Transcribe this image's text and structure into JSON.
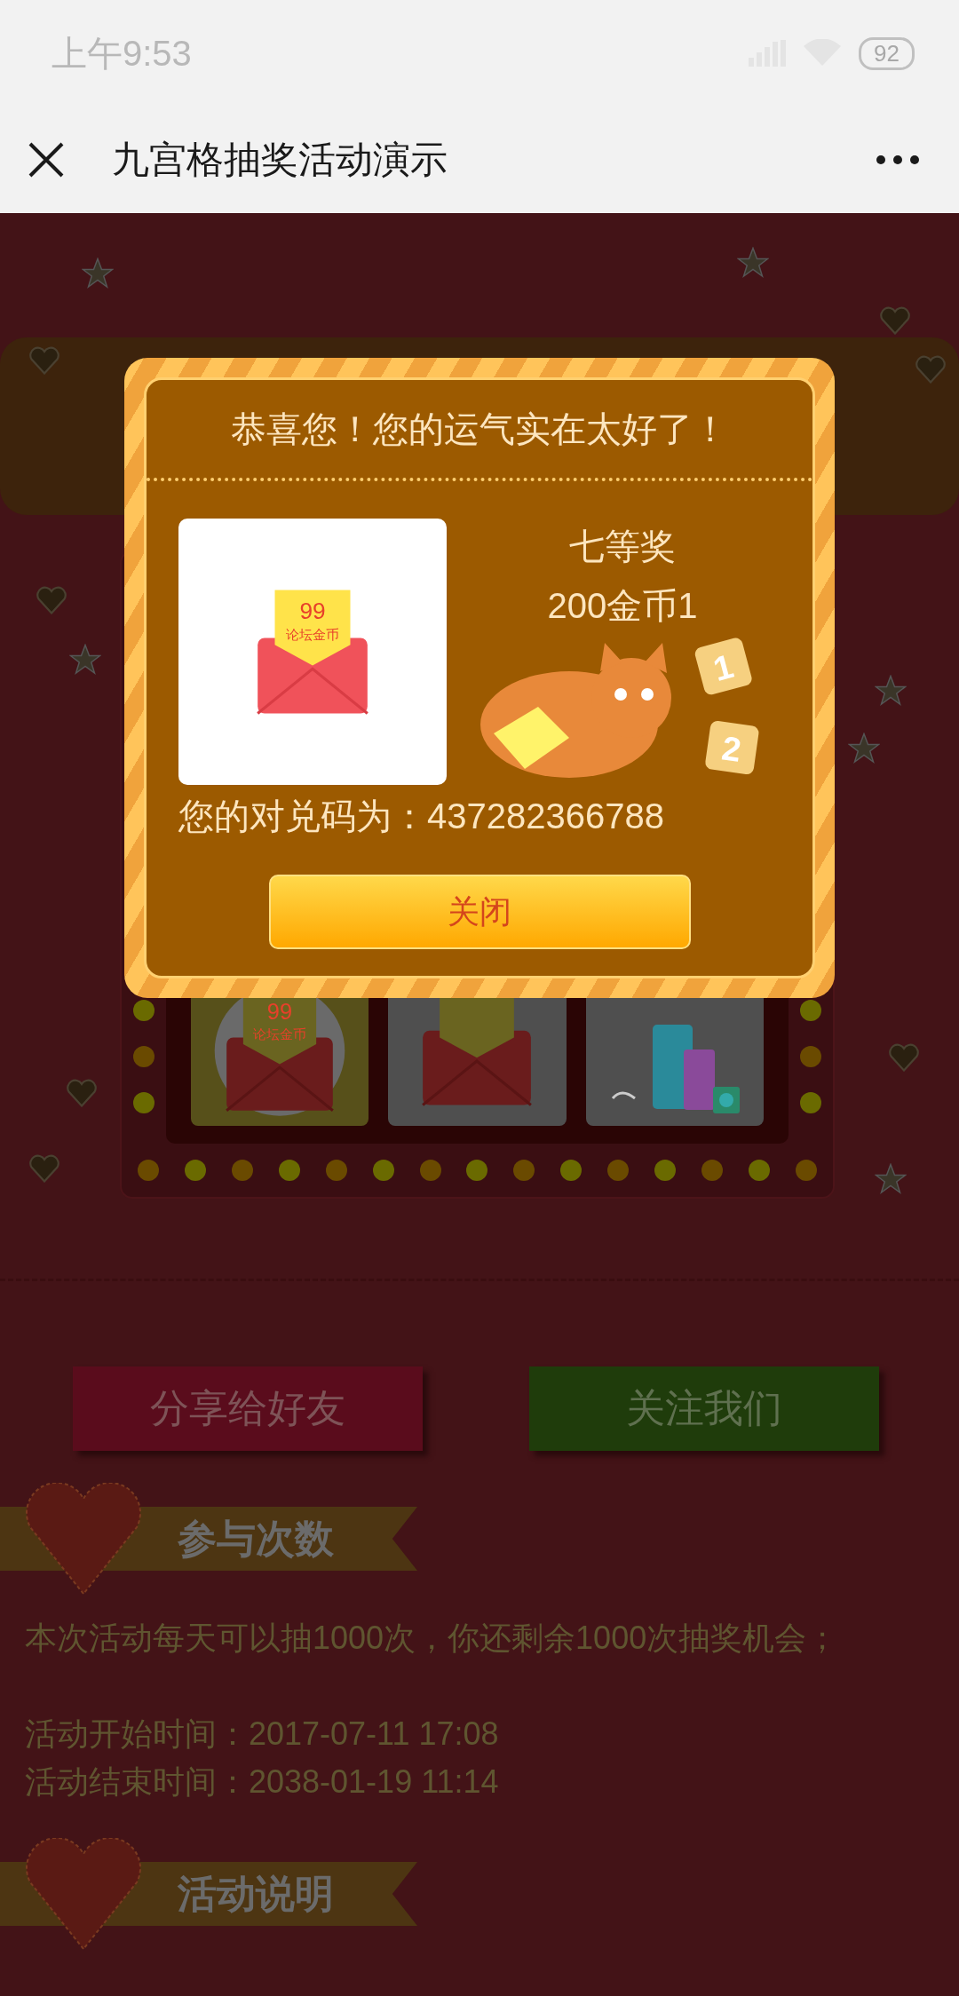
{
  "status_bar": {
    "time": "上午9:53",
    "battery": "92"
  },
  "nav": {
    "title": "九宫格抽奖活动演示"
  },
  "grid": {
    "cells": [
      {
        "kind": "coins",
        "amount": "99",
        "label": "论坛金币",
        "selected": true
      },
      {
        "kind": "envelope",
        "selected": false
      },
      {
        "kind": "device",
        "selected": false
      }
    ]
  },
  "actions": [
    {
      "kind": "share",
      "label": "分享给好友"
    },
    {
      "kind": "follow",
      "label": "关注我们"
    }
  ],
  "sections": [
    {
      "title": "参与次数",
      "paragraphs": [
        "本次活动每天可以抽1000次，你还剩余1000次抽奖机会；"
      ],
      "lines": [
        "活动开始时间：2017-07-11 17:08",
        "活动结束时间：2038-01-19 11:14"
      ]
    },
    {
      "title": "活动说明"
    }
  ],
  "dialog": {
    "title": "恭喜您！您的运气实在太好了！",
    "prize_image": {
      "amount": "99",
      "label": "论坛金币"
    },
    "prize_name": "七等奖",
    "prize_detail": "200金币1",
    "dice": [
      "1",
      "2"
    ],
    "code_text": "您的对兑码为：437282366788",
    "close_button": "关闭"
  }
}
